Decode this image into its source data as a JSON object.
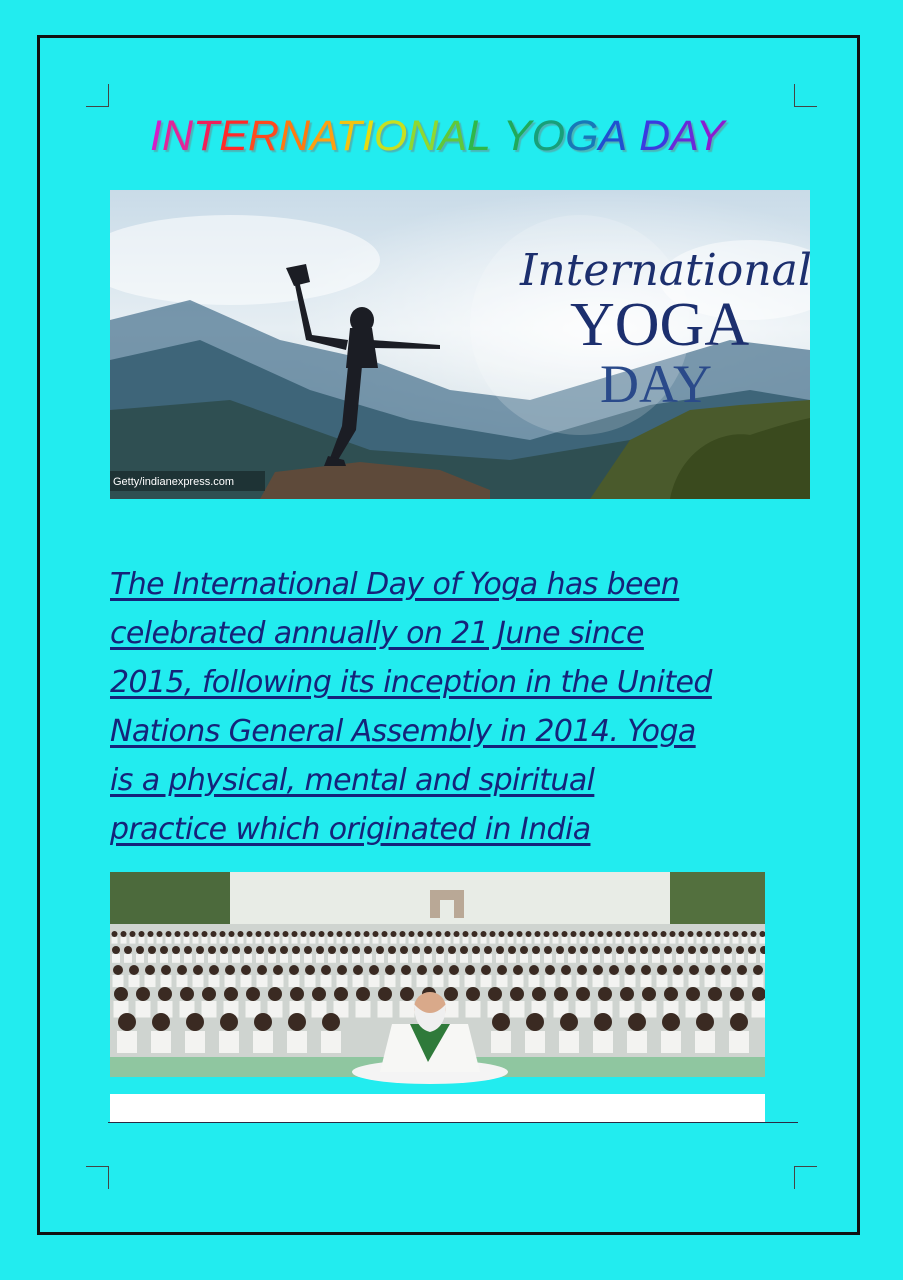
{
  "title": {
    "segments": [
      {
        "text": "I",
        "color": "#d21ec8"
      },
      {
        "text": "N",
        "color": "#e0269a"
      },
      {
        "text": "T",
        "color": "#f0205a"
      },
      {
        "text": "E",
        "color": "#ff2a2a"
      },
      {
        "text": "R",
        "color": "#ff4a1e"
      },
      {
        "text": "N",
        "color": "#ff7a10"
      },
      {
        "text": "A",
        "color": "#ffa010"
      },
      {
        "text": "T",
        "color": "#f4c410"
      },
      {
        "text": "I",
        "color": "#e8dc10"
      },
      {
        "text": "O",
        "color": "#c8e020"
      },
      {
        "text": "N",
        "color": "#90d830"
      },
      {
        "text": "A",
        "color": "#60c83a"
      },
      {
        "text": "L",
        "color": "#2eb84a"
      },
      {
        "text": " ",
        "color": "#2eb84a"
      },
      {
        "text": "Y",
        "color": "#1faa5a"
      },
      {
        "text": "O",
        "color": "#17a07a"
      },
      {
        "text": "G",
        "color": "#1878b8"
      },
      {
        "text": "A",
        "color": "#2050d0"
      },
      {
        "text": " ",
        "color": "#2050d0"
      },
      {
        "text": "D",
        "color": "#3a3ae0"
      },
      {
        "text": "A",
        "color": "#6a2ad8"
      },
      {
        "text": "Y",
        "color": "#8a1ed0"
      }
    ]
  },
  "banner": {
    "script_word": "International",
    "word_yoga": "YOGA",
    "word_day": "DAY",
    "credit": "Getty/indianexpress.com"
  },
  "paragraph": {
    "lines": [
      "The International Day of Yoga has been",
      "celebrated annually on 21 June since",
      "2015, following its inception in the United",
      "Nations General Assembly in 2014. Yoga",
      "is a physical, mental and spiritual",
      "practice which originated in India"
    ]
  },
  "colors": {
    "page_background": "#22ecef",
    "paragraph_text": "#15237a",
    "banner_text": "#1c2f6e"
  }
}
